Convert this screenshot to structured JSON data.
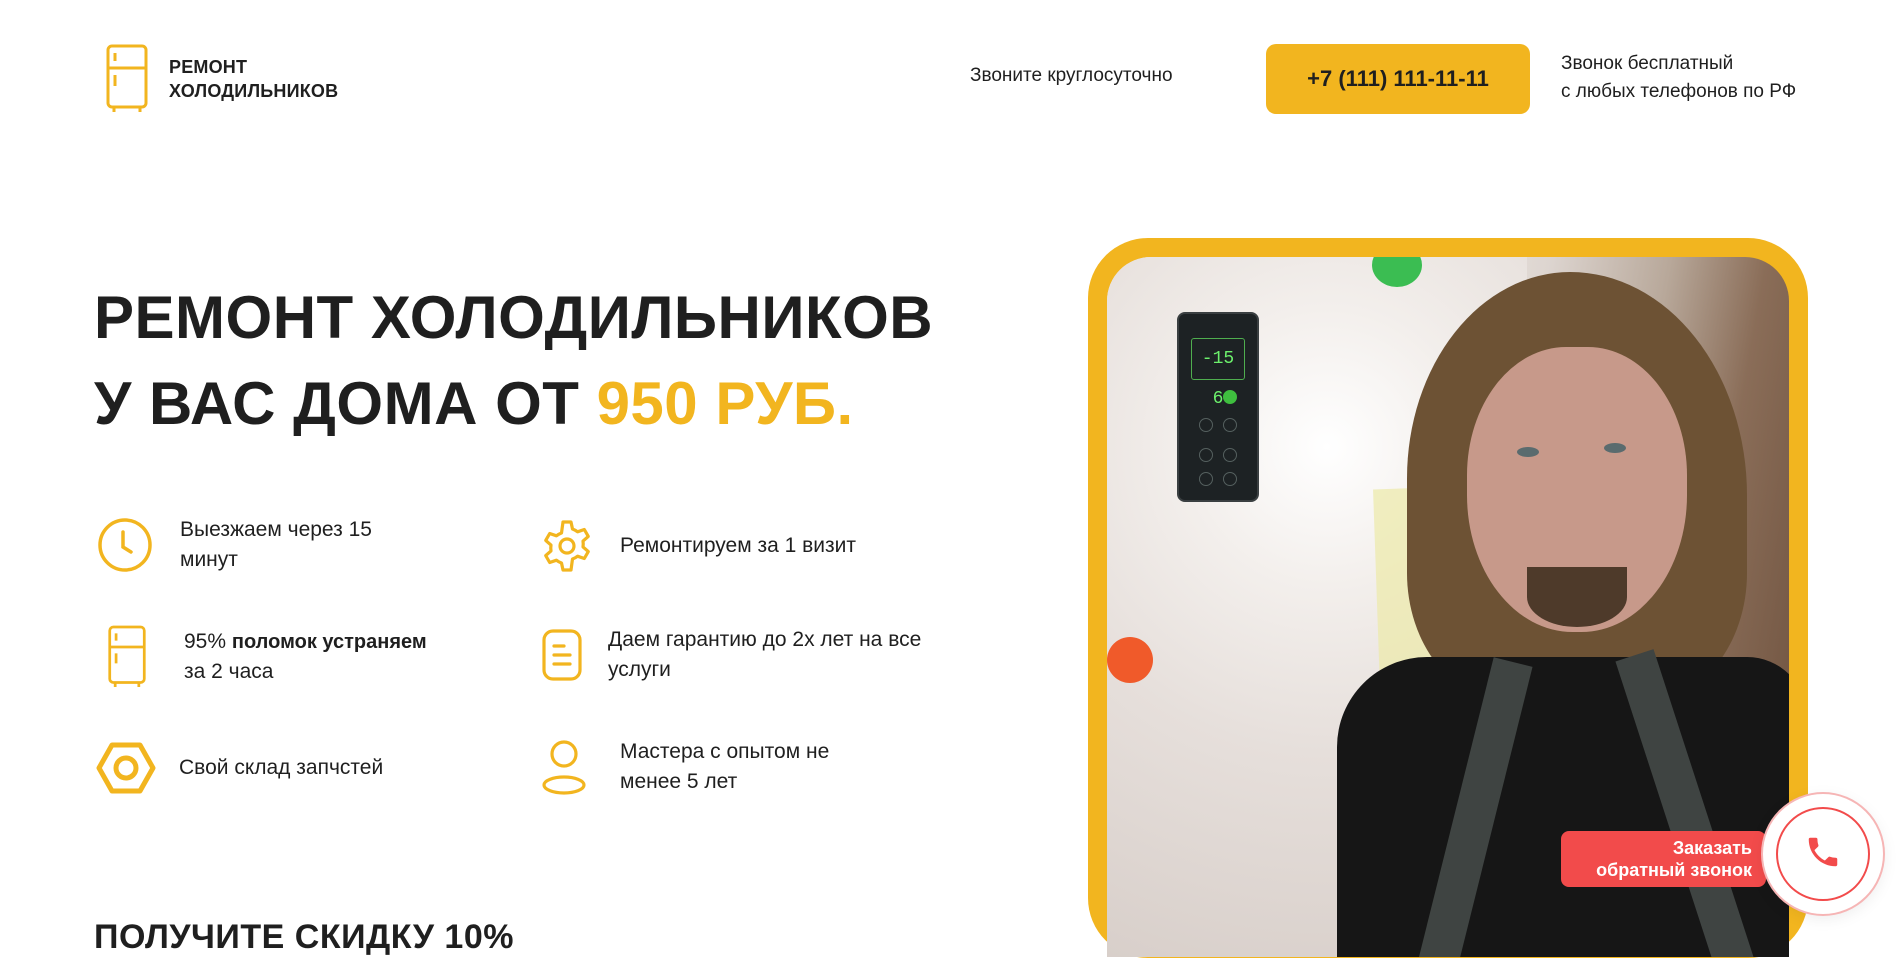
{
  "header": {
    "logo_icon": "fridge-icon",
    "logo_line1": "РЕМОНТ",
    "logo_line2": "ХОЛОДИЛЬНИКОВ",
    "hours": "Звоните круглосуточно",
    "phone": "+7 (111) 111-11-11",
    "free_line1": "Звонок бесплатный",
    "free_line2": "с любых телефонов по РФ"
  },
  "hero": {
    "title_line1": "РЕМОНТ ХОЛОДИЛЬНИКОВ",
    "title_line2_prefix": "У ВАС ДОМА ОТ ",
    "title_price": "950 РУБ."
  },
  "features": [
    {
      "icon": "clock-icon",
      "text": "Выезжаем через 15 минут"
    },
    {
      "icon": "gear-icon",
      "text": "Ремонтируем за 1 визит"
    },
    {
      "icon": "fridge-icon",
      "text_prefix": "95%",
      "text_bold": "поломок устраняем",
      "text_suffix": "за 2 часа"
    },
    {
      "icon": "document-icon",
      "text": "Даем гарантию до 2х лет на все услуги"
    },
    {
      "icon": "nut-icon",
      "text": "Свой склад запчстей"
    },
    {
      "icon": "user-icon",
      "text": "Мастера с опытом не менее 5 лет"
    }
  ],
  "discount": {
    "title": "ПОЛУЧИТЕ СКИДКУ 10%"
  },
  "photo": {
    "display_temp": "-15 6"
  },
  "callback": {
    "line1": "Заказать",
    "line2": "обратный звонок",
    "icon": "phone-icon"
  },
  "colors": {
    "accent": "#f2b51f",
    "callback": "#f24b4b",
    "text": "#1f1f1f"
  }
}
